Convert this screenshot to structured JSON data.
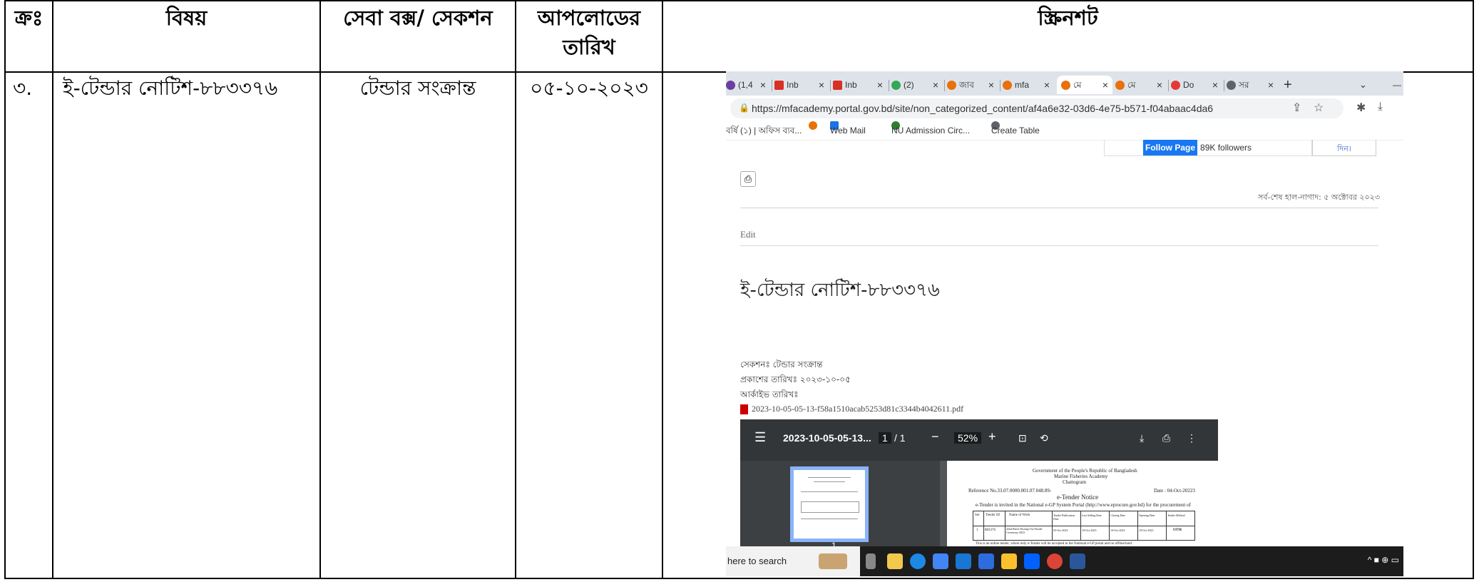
{
  "table": {
    "headers": [
      "ক্রঃ",
      "বিষয়",
      "সেবা বক্স/ সেকশন",
      "আপলোডের তারিখ",
      "স্ক্রিনশট"
    ],
    "row": {
      "serial": "৩.",
      "subject": "ই-টেন্ডার নোটিশ-৮৮৩৩৭৬",
      "section": "টেন্ডার সংক্রান্ত",
      "date": "০৫-১০-২০২৩"
    }
  },
  "screenshot": {
    "tabs": [
      "(1,4",
      "Inb",
      "Inb",
      "(2)",
      "জাব",
      "mfa",
      "মে",
      "মে",
      "Do",
      "সর"
    ],
    "new_tab": "+",
    "url": "https://mfacademy.portal.gov.bd/site/non_categorized_content/af4a6e32-03d6-4e75-b571-f04abaac4da6",
    "bookmarks": [
      "বর্ষি (১) | অফিস ব্যব...",
      "Web Mail",
      "NU Admission Circ...",
      "Create Table"
    ],
    "follow_label": "Follow Page",
    "followers": "89K followers",
    "dibox": "দিন।",
    "last_updated": "সর্ব-শেষ হাল-নাগাদ: ৫ অক্টোবর ২০২৩",
    "edit": "Edit",
    "page_title": "ই-টেন্ডার নোটিশ-৮৮৩৩৭৬",
    "section_line": "সেকশনঃ টেন্ডার সংক্রান্ত",
    "published_line": "প্রকাশের তারিখঃ ২০২৩-১০-০৫",
    "archive_line": "আর্কাইভ তারিখঃ",
    "pdf_name": "2023-10-05-05-13-f58a1510acab5253d81c3344b4042611.pdf",
    "viewer": {
      "file": "2023-10-05-05-13...",
      "page": "1",
      "total": "/ 1",
      "zoom": "52%",
      "thumb_num": "1"
    },
    "doc": {
      "gov": "Government of the People's Republic of Bangladesh",
      "academy": "Marine Fisheries Academy",
      "city": "Chattogram",
      "ref": "Reference No.33.07.0000.001.07.048.89-",
      "date": "Date : 04-Oct-20223",
      "notice": "e-Tender Notice",
      "intro": "e-Tender is invited in the National e-GP System Portal (http://www.eprocure.gov.bd) for the procurement of",
      "cols": [
        "Ser",
        "Tender ID",
        "Name of Work",
        "Tender Publication Date",
        "Last Selling Date",
        "Closing Date",
        "Opening Date",
        "Tender Method"
      ],
      "vals": [
        "1",
        "883376",
        "42nd Batch Passing Out Parade Ceremony-2023",
        "05-Oct-2023",
        "19-Oct-2023",
        "19-Oct-2023",
        "19-Oct-2023",
        "OTM"
      ],
      "foot": "This is an online tender, where only e-Tender will be accepted in the National e-GP portal and no offline/hard"
    },
    "taskbar_search": "here to search"
  }
}
